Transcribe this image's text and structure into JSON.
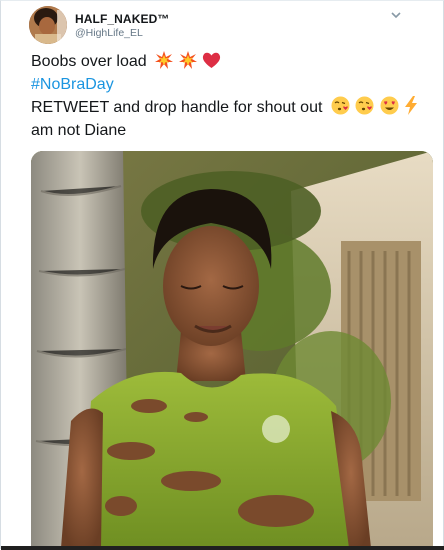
{
  "tweet": {
    "display_name": "HALF_NAKED™",
    "handle": "@HighLife_EL",
    "lines": [
      "Boobs over load",
      "#NoBraDay",
      "RETWEET and drop handle for shout out",
      "am not Diane"
    ],
    "emoji_line1": [
      "collision-icon",
      "collision-icon",
      "red-heart-icon"
    ],
    "emoji_line3": [
      "face-blowing-kiss-icon",
      "face-blowing-kiss-icon",
      "heart-eyes-icon",
      "high-voltage-icon"
    ],
    "hashtag_color": "#1b95e0",
    "text_color": "#14171a",
    "handle_color": "#657786"
  },
  "media": {
    "description_icon": "photo-icon"
  }
}
